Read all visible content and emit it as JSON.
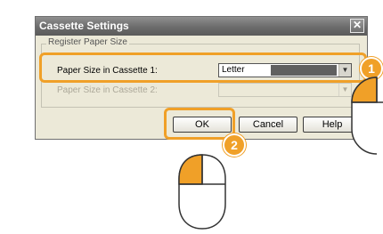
{
  "dialog": {
    "title": "Cassette Settings",
    "close_symbol": "✕",
    "group_legend": "Register Paper Size",
    "cassette1_label": "Paper Size in Cassette 1:",
    "cassette1_value": "Letter",
    "cassette2_label": "Paper Size in Cassette 2:",
    "ok_label": "OK",
    "cancel_label": "Cancel",
    "help_label": "Help"
  },
  "callouts": {
    "step1": "1",
    "step2": "2"
  },
  "colors": {
    "highlight": "#f0a028",
    "titlebar": "#6c6c6c",
    "dialog_bg": "#ece9d8"
  }
}
